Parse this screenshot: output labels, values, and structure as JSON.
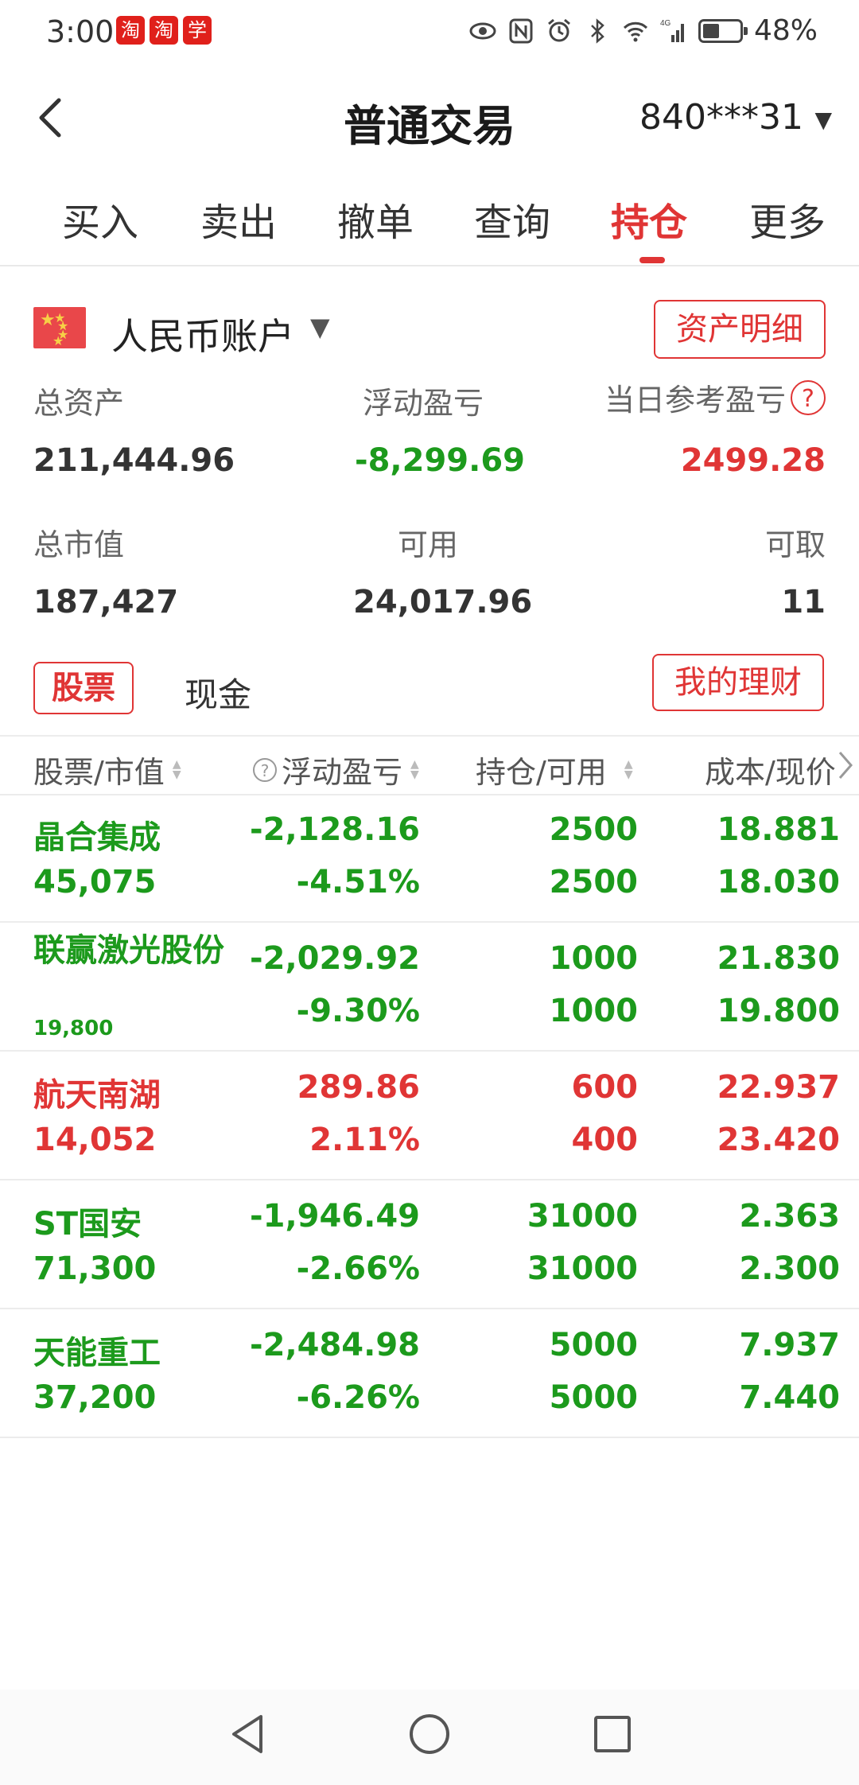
{
  "status_bar": {
    "time": "3:00",
    "battery": "48%",
    "app_icons": [
      "淘",
      "淘",
      "学"
    ],
    "network": "4G"
  },
  "header": {
    "title": "普通交易",
    "account": "840***31"
  },
  "tabs": [
    {
      "label": "买入",
      "active": false
    },
    {
      "label": "卖出",
      "active": false
    },
    {
      "label": "撤单",
      "active": false
    },
    {
      "label": "查询",
      "active": false
    },
    {
      "label": "持仓",
      "active": true
    },
    {
      "label": "更多",
      "active": false
    }
  ],
  "account": {
    "name": "人民币账户",
    "detail_button": "资产明细",
    "total_assets_label": "总资产",
    "total_assets": "211,444.96",
    "float_pl_label": "浮动盈亏",
    "float_pl": "-8,299.69",
    "daily_pl_label": "当日参考盈亏",
    "daily_pl": "2499.28",
    "market_value_label": "总市值",
    "market_value": "187,427",
    "available_label": "可用",
    "available": "24,017.96",
    "withdrawable_label": "可取",
    "withdrawable": "11"
  },
  "asset_tabs": {
    "stock": "股票",
    "cash": "现金",
    "wealth_button": "我的理财"
  },
  "table": {
    "headers": [
      "股票/市值",
      "浮动盈亏",
      "持仓/可用",
      "成本/现价"
    ],
    "rows": [
      {
        "name": "晶合集成",
        "market_value": "45,075",
        "pl": "-2,128.16",
        "pl_pct": "-4.51%",
        "position": "2500",
        "available": "2500",
        "cost": "18.881",
        "price": "18.030",
        "trend": "down"
      },
      {
        "name": "联赢激光股份",
        "market_value": "19,800",
        "pl": "-2,029.92",
        "pl_pct": "-9.30%",
        "position": "1000",
        "available": "1000",
        "cost": "21.830",
        "price": "19.800",
        "trend": "down"
      },
      {
        "name": "航天南湖",
        "market_value": "14,052",
        "pl": "289.86",
        "pl_pct": "2.11%",
        "position": "600",
        "available": "400",
        "cost": "22.937",
        "price": "23.420",
        "trend": "up"
      },
      {
        "name": "ST国安",
        "market_value": "71,300",
        "pl": "-1,946.49",
        "pl_pct": "-2.66%",
        "position": "31000",
        "available": "31000",
        "cost": "2.363",
        "price": "2.300",
        "trend": "down"
      },
      {
        "name": "天能重工",
        "market_value": "37,200",
        "pl": "-2,484.98",
        "pl_pct": "-6.26%",
        "position": "5000",
        "available": "5000",
        "cost": "7.937",
        "price": "7.440",
        "trend": "down"
      }
    ]
  },
  "colors": {
    "accent": "#e03535",
    "up": "#e03535",
    "down": "#1c9a1c"
  }
}
